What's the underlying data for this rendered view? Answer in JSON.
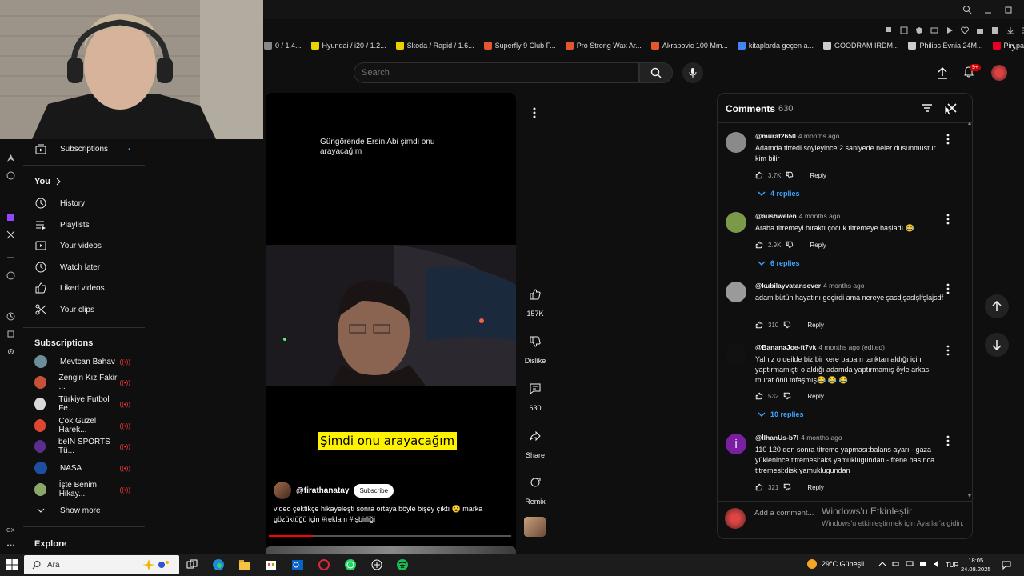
{
  "bookmarks": [
    {
      "label": "0 / 1.4...",
      "color": "#888888"
    },
    {
      "label": "Hyundai / i20 / 1.2...",
      "color": "#e9d200"
    },
    {
      "label": "Skoda / Rapid / 1.6...",
      "color": "#e9d200"
    },
    {
      "label": "Superfly 9 Club F...",
      "color": "#e2572b"
    },
    {
      "label": "Pro Strong Wax Ar...",
      "color": "#e2572b"
    },
    {
      "label": "Akrapovic 100 Mm...",
      "color": "#e2572b"
    },
    {
      "label": "kitaplarda geçen a...",
      "color": "#4285f4"
    },
    {
      "label": "GOODRAM IRDM...",
      "color": "#cccccc"
    },
    {
      "label": "Philips Evnia 24M...",
      "color": "#cccccc"
    },
    {
      "label": "Pin page",
      "color": "#e60023"
    }
  ],
  "search": {
    "placeholder": "Search"
  },
  "header": {
    "notification_count": "9+"
  },
  "sidebar": {
    "subscriptions_top": "Subscriptions",
    "you_label": "You",
    "you_items": [
      "History",
      "Playlists",
      "Your videos",
      "Watch later",
      "Liked videos",
      "Your clips"
    ],
    "subscriptions_heading": "Subscriptions",
    "channels": [
      {
        "name": "Mevtcan Bahav",
        "color": "#6b8e9b"
      },
      {
        "name": "Zengin Kız Fakir ...",
        "color": "#c8503a"
      },
      {
        "name": "Türkiye Futbol Fe...",
        "color": "#d9d9d9"
      },
      {
        "name": "Çok Güzel Harek...",
        "color": "#e0452f"
      },
      {
        "name": "beIN SPORTS Tü...",
        "color": "#5b2d8e"
      },
      {
        "name": "NASA",
        "color": "#1d4fa0"
      },
      {
        "name": "İşte Benim Hikay...",
        "color": "#8aa86a"
      }
    ],
    "show_more": "Show more",
    "explore": "Explore"
  },
  "video": {
    "top_text": "Güngörende Ersin Abi şimdi onu arayacağım",
    "caption": "Şimdi onu arayacağım",
    "channel": "@firathanatay",
    "subscribe": "Subscribe",
    "description": "video çektikçe hikayeleşti sonra ortaya böyle bişey çıktı 😮 marka gözüktüğü için #reklam #işbirliği",
    "progress_fraction": 0.18
  },
  "actions": {
    "likes": "157K",
    "dislike": "Dislike",
    "comments": "630",
    "share": "Share",
    "remix": "Remix"
  },
  "comments": {
    "title": "Comments",
    "count": "630",
    "items": [
      {
        "author": "@murat2650",
        "time": "4 months ago",
        "text": "Adamda titredi soyleyince 2 saniyede neler dusunmustur kim bilir",
        "likes": "3.7K",
        "reply": "Reply",
        "replies": "4 replies",
        "avatar": "#8a8a8a"
      },
      {
        "author": "@aushwelen",
        "time": "4 months ago",
        "text": "Araba titremeyi bıraktı çocuk titremeye başladı 😂",
        "likes": "2.9K",
        "reply": "Reply",
        "replies": "6 replies",
        "avatar": "#7a9a4a"
      },
      {
        "author": "@kubilayvatansever",
        "time": "4 months ago",
        "text": "adam bütün hayatını geçirdi ama nereye şasdjşaslşlfşlajsdf",
        "likes": "310",
        "reply": "Reply",
        "replies": "",
        "avatar": "#9a9a9a"
      },
      {
        "author": "@BananaJoe-ft7vk",
        "time": "4 months ago (edited)",
        "text": "Yalnız o deilde biz bir kere babam tanktan aldığı için yaptırmamıştı o aldığı adamda yaptırmamış öyle arkası murat önü tofaşmış😂 😂 😂",
        "likes": "532",
        "reply": "Reply",
        "replies": "10 replies",
        "avatar": "#111111"
      },
      {
        "author": "@İlhanUs-b7l",
        "time": "4 months ago",
        "text": "110 120 den sonra titreme yapması:balans ayarı - gaza yüklenince titremesi:aks yamuklugundan - frene basınca titremesi:disk yamuklugundan",
        "likes": "321",
        "reply": "Reply",
        "replies": "",
        "avatar": "#7b1fa2",
        "initial": "İ"
      }
    ],
    "add_placeholder": "Add a comment..."
  },
  "watermark": {
    "line1": "Windows'u Etkinleştir",
    "line2": "Windows'u etkinleştirmek için Ayarlar'a gidin."
  },
  "taskbar": {
    "search_label": "Ara",
    "weather": "29°C Güneşli",
    "lang": "TUR",
    "time": "18:05",
    "date": "24.08.2025"
  }
}
